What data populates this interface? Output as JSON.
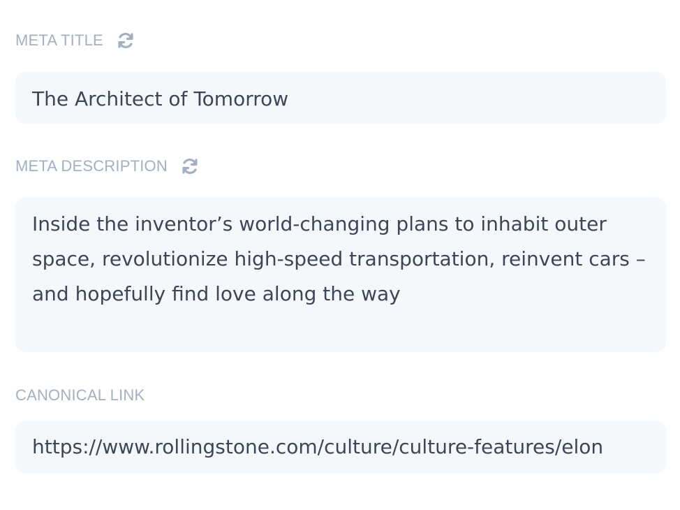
{
  "meta_title": {
    "label": "META TITLE",
    "value": "The Architect of Tomorrow",
    "refresh_icon": "refresh-icon"
  },
  "meta_description": {
    "label": "META DESCRIPTION",
    "value": "Inside the inventor’s world-changing plans to inhabit outer space, revolutionize high-speed transportation, reinvent cars – and hopefully find love along the way",
    "refresh_icon": "refresh-icon"
  },
  "canonical_link": {
    "label": "CANONICAL LINK",
    "value": "https://www.rollingstone.com/culture/culture-features/elon"
  },
  "colors": {
    "label": "#a3b0c2",
    "field_bg": "#f5f8fb",
    "text": "#3d4657"
  }
}
